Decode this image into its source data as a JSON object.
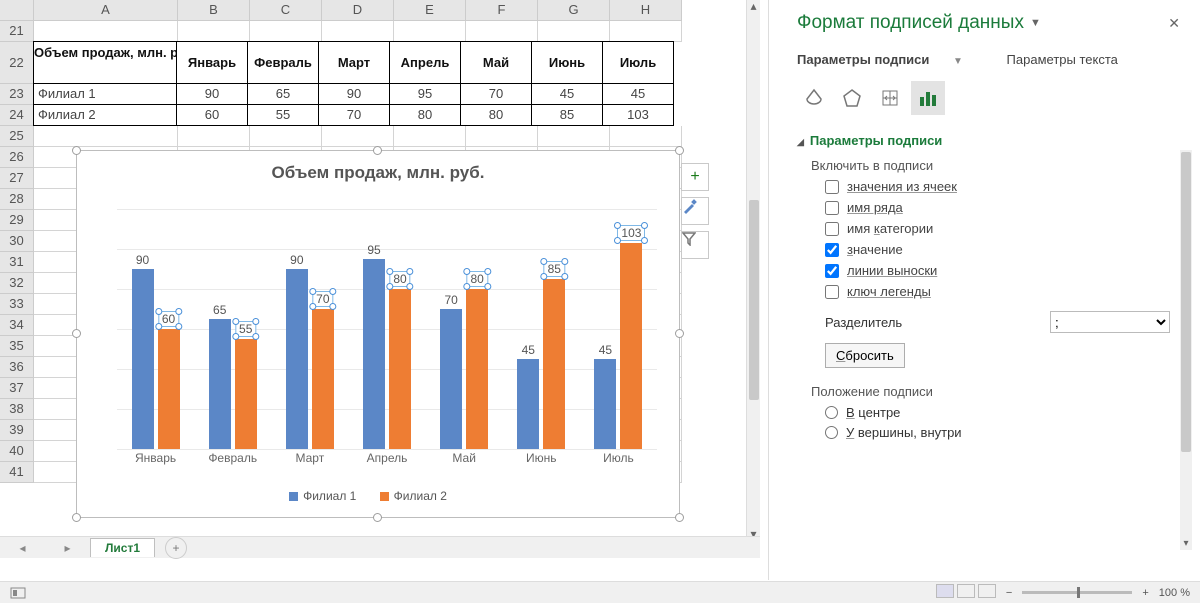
{
  "columns": [
    "A",
    "B",
    "C",
    "D",
    "E",
    "F",
    "G",
    "H"
  ],
  "rowStart": 21,
  "table": {
    "header": [
      "Объем продаж, млн. руб.",
      "Январь",
      "Февраль",
      "Март",
      "Апрель",
      "Май",
      "Июнь",
      "Июль"
    ],
    "rows": [
      [
        "Филиал 1",
        "90",
        "65",
        "90",
        "95",
        "70",
        "45",
        "45"
      ],
      [
        "Филиал 2",
        "60",
        "55",
        "70",
        "80",
        "80",
        "85",
        "103"
      ]
    ]
  },
  "sheetTab": "Лист1",
  "pane": {
    "title": "Формат подписей данных",
    "tab1": "Параметры подписи",
    "tab2": "Параметры текста",
    "section": "Параметры подписи",
    "include": "Включить в подписи",
    "opts": {
      "cells": "значения из ячеек",
      "series": "имя ряда",
      "cat": "имя категории",
      "val": "значение",
      "leader": "линии выноски",
      "legendkey": "ключ легенды"
    },
    "sep_label": "Разделитель",
    "sep_value": ";",
    "reset": "Сбросить",
    "pos_label": "Положение подписи",
    "pos_center": "В центре",
    "pos_top_in": "У вершины, внутри"
  },
  "zoom": "100 %",
  "chart_data": {
    "type": "bar",
    "title": "Объем продаж, млн. руб.",
    "categories": [
      "Январь",
      "Февраль",
      "Март",
      "Апрель",
      "Май",
      "Июнь",
      "Июль"
    ],
    "series": [
      {
        "name": "Филиал 1",
        "values": [
          90,
          65,
          90,
          95,
          70,
          45,
          45
        ]
      },
      {
        "name": "Филиал 2",
        "values": [
          60,
          55,
          70,
          80,
          80,
          85,
          103
        ]
      }
    ],
    "ylim": [
      0,
      120
    ],
    "yticks": [
      0,
      20,
      40,
      60,
      80,
      100,
      120
    ],
    "xlabel": "",
    "ylabel": "",
    "selected_series_index": 1
  }
}
